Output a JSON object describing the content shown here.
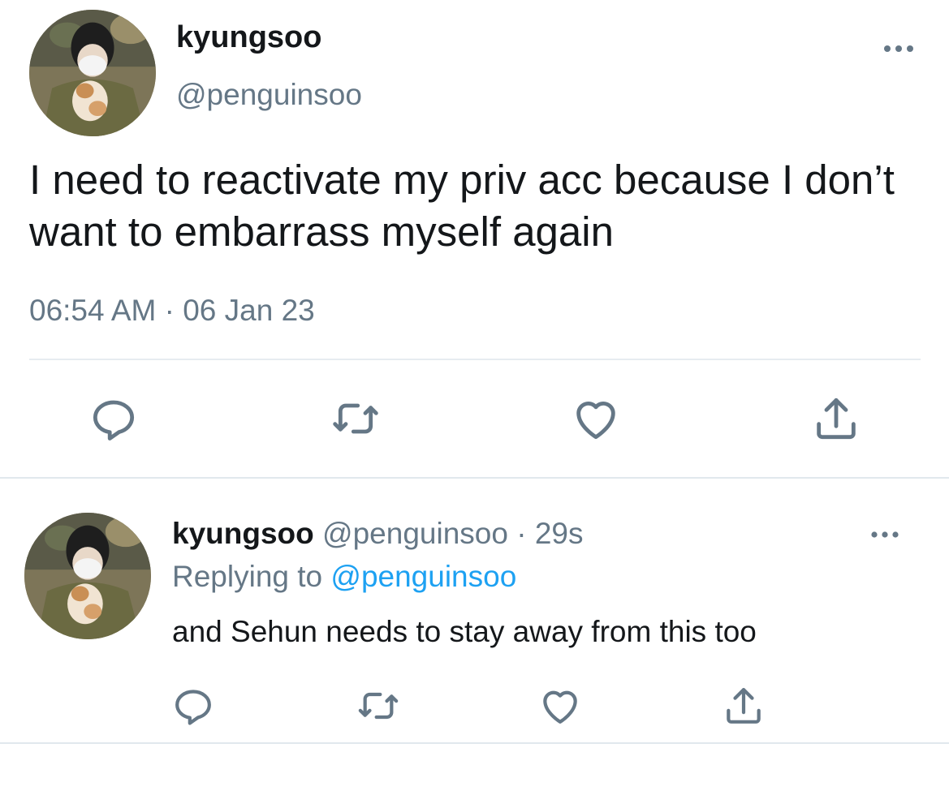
{
  "main_tweet": {
    "display_name": "kyungsoo",
    "handle": "@penguinsoo",
    "text": "I need to reactivate my priv acc because I don’t want to embarrass myself again",
    "timestamp": "06:54 AM · 06 Jan 23",
    "actions": [
      "reply-icon",
      "retweet-icon",
      "like-icon",
      "share-icon"
    ]
  },
  "reply_tweet": {
    "display_name": "kyungsoo",
    "handle": "@penguinsoo",
    "separator": "·",
    "time_ago": "29s",
    "replying_prefix": "Replying to",
    "replying_to": "@penguinsoo",
    "text": "and Sehun needs to stay away from this too",
    "actions": [
      "reply-icon",
      "retweet-icon",
      "like-icon",
      "share-icon"
    ]
  },
  "colors": {
    "text_primary": "#14171a",
    "text_secondary": "#657786",
    "link": "#1da1f2",
    "icon": "#657786",
    "divider": "#e6ecf0"
  }
}
